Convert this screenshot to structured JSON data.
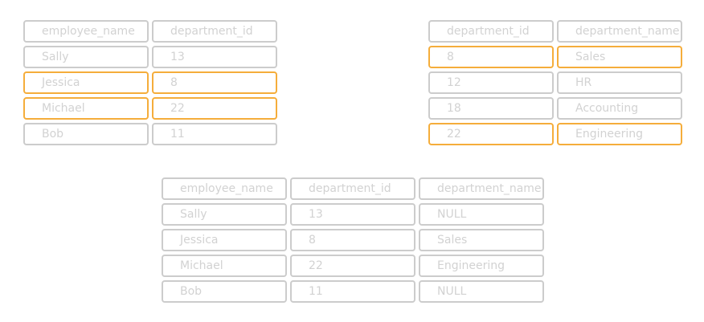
{
  "colors": {
    "border": "#cccccc",
    "highlight": "#f5ad3b",
    "text": "#d2d2d2"
  },
  "tables": [
    {
      "id": "employees-table",
      "columns": [
        "employee_name",
        "department_id"
      ],
      "rows": [
        {
          "cells": [
            "Sally",
            "13"
          ],
          "highlighted": false
        },
        {
          "cells": [
            "Jessica",
            "8"
          ],
          "highlighted": true
        },
        {
          "cells": [
            "Michael",
            "22"
          ],
          "highlighted": true
        },
        {
          "cells": [
            "Bob",
            "11"
          ],
          "highlighted": false
        }
      ]
    },
    {
      "id": "departments-table",
      "columns": [
        "department_id",
        "department_name"
      ],
      "rows": [
        {
          "cells": [
            "8",
            "Sales"
          ],
          "highlighted": true
        },
        {
          "cells": [
            "12",
            "HR"
          ],
          "highlighted": false
        },
        {
          "cells": [
            "18",
            "Accounting"
          ],
          "highlighted": false
        },
        {
          "cells": [
            "22",
            "Engineering"
          ],
          "highlighted": true
        }
      ]
    },
    {
      "id": "joined-table",
      "columns": [
        "employee_name",
        "department_id",
        "department_name"
      ],
      "rows": [
        {
          "cells": [
            "Sally",
            "13",
            "NULL"
          ],
          "highlighted": false
        },
        {
          "cells": [
            "Jessica",
            "8",
            "Sales"
          ],
          "highlighted": false
        },
        {
          "cells": [
            "Michael",
            "22",
            "Engineering"
          ],
          "highlighted": false
        },
        {
          "cells": [
            "Bob",
            "11",
            "NULL"
          ],
          "highlighted": false
        }
      ]
    }
  ]
}
